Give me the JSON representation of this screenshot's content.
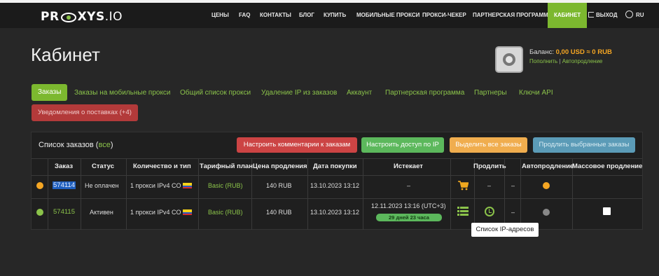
{
  "header": {
    "logo_main": "PR",
    "logo_mid": "XYS",
    "logo_sfx": ".IO",
    "nav": [
      "ЦЕНЫ",
      "FAQ",
      "КОНТАКТЫ",
      "БЛОГ",
      "КУПИТЬ",
      "МОБИЛЬНЫЕ ПРОКСИ",
      "ПРОКСИ-ЧЕКЕР",
      "ПАРТНЕРСКАЯ ПРОГРАММА",
      "КАБИНЕТ",
      "ВЫХОД",
      "RU"
    ],
    "active_nav": "КАБИНЕТ"
  },
  "page_title": "Кабинет",
  "balance": {
    "label": "Баланс:",
    "amount": "0,00 USD ≈ 0 RUB",
    "topup": "Пополнить",
    "sep": "|",
    "autotopup": "Автопродление"
  },
  "tabs": [
    "Заказы",
    "Заказы на мобильные прокси",
    "Общий список прокси",
    "Удаление IP из заказов",
    "Аккаунт",
    "Партнерская программа",
    "Партнеры",
    "Ключи API"
  ],
  "notification": "Уведомления о поставках (+4)",
  "panel": {
    "title": "Список заказов (",
    "all": "все",
    "close": ")",
    "buttons": {
      "comments": "Настроить комментарии к заказам",
      "ip_access": "Настроить доступ по IP",
      "select_all": "Выделить все заказы",
      "renew_selected": "Продлить выбранные заказы"
    }
  },
  "table": {
    "headers": [
      "Заказ",
      "Статус",
      "Количество и тип",
      "Тарифный план",
      "Цена продления",
      "Дата покупки",
      "Истекает",
      "Продлить",
      "Автопродление",
      "Массовое продление"
    ],
    "rows": [
      {
        "order": "574114",
        "status": "Не оплачен",
        "qty": "1 прокси IPv4 CO",
        "plan": "Basic (RUB)",
        "price": "140 RUB",
        "date": "13.10.2023 13:12",
        "expires": "–",
        "renew_dash": "–",
        "extra_dash": "–",
        "status_color": "#f5a623",
        "auto_color": "#f5a623"
      },
      {
        "order": "574115",
        "status": "Активен",
        "qty": "1 прокси IPv4 CO",
        "plan": "Basic (RUB)",
        "price": "140 RUB",
        "date": "13.10.2023 13:12",
        "expires": "12.11.2023 13:16 (UTC+3)",
        "days_left": "29 дней 23 часа",
        "extra_dash": "–",
        "status_color": "#8bc34a",
        "auto_color": "#888888"
      }
    ]
  },
  "tooltip": "Список IP-адресов",
  "colors": {
    "accent": "#7cb82f",
    "warning": "#f5a623",
    "danger": "#cc4444"
  }
}
